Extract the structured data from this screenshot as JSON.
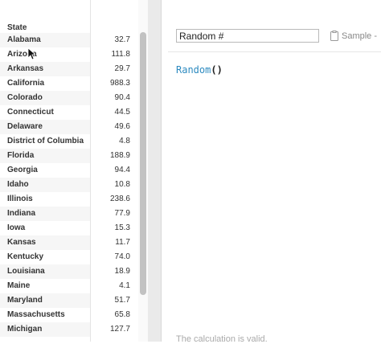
{
  "table": {
    "header": "State",
    "rows": [
      {
        "state": "Alabama",
        "value": "32.7"
      },
      {
        "state": "Arizona",
        "value": "111.8"
      },
      {
        "state": "Arkansas",
        "value": "29.7"
      },
      {
        "state": "California",
        "value": "988.3"
      },
      {
        "state": "Colorado",
        "value": "90.4"
      },
      {
        "state": "Connecticut",
        "value": "44.5"
      },
      {
        "state": "Delaware",
        "value": "49.6"
      },
      {
        "state": "District of Columbia",
        "value": "4.8"
      },
      {
        "state": "Florida",
        "value": "188.9"
      },
      {
        "state": "Georgia",
        "value": "94.4"
      },
      {
        "state": "Idaho",
        "value": "10.8"
      },
      {
        "state": "Illinois",
        "value": "238.6"
      },
      {
        "state": "Indiana",
        "value": "77.9"
      },
      {
        "state": "Iowa",
        "value": "15.3"
      },
      {
        "state": "Kansas",
        "value": "11.7"
      },
      {
        "state": "Kentucky",
        "value": "74.0"
      },
      {
        "state": "Louisiana",
        "value": "18.9"
      },
      {
        "state": "Maine",
        "value": "4.1"
      },
      {
        "state": "Maryland",
        "value": "51.7"
      },
      {
        "state": "Massachusetts",
        "value": "65.8"
      },
      {
        "state": "Michigan",
        "value": "127.7"
      }
    ]
  },
  "editor": {
    "calc_name": "Random #",
    "sample_label": "Sample -",
    "sample_icon": "clipboard-icon",
    "formula_func": "Random",
    "formula_parens": "()",
    "status": "The calculation is valid."
  },
  "colors": {
    "function_blue": "#2e8bc0",
    "status_gray": "#aaaaaa"
  }
}
